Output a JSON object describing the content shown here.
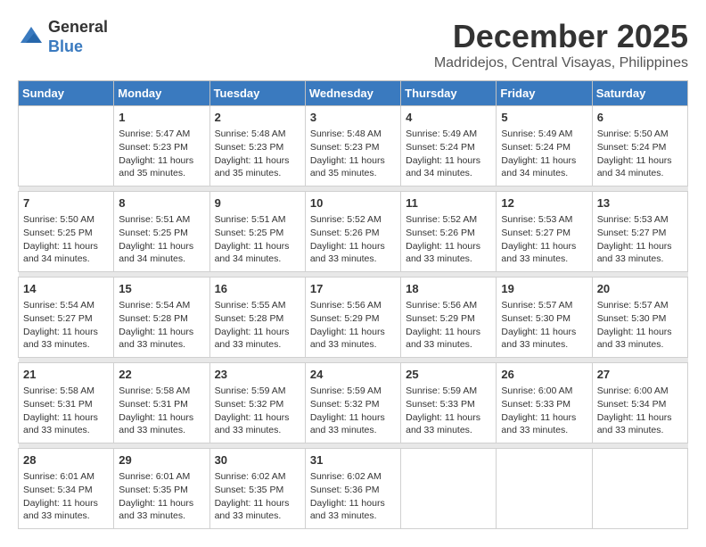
{
  "header": {
    "logo_general": "General",
    "logo_blue": "Blue",
    "title": "December 2025",
    "subtitle": "Madridejos, Central Visayas, Philippines"
  },
  "calendar": {
    "weekdays": [
      "Sunday",
      "Monday",
      "Tuesday",
      "Wednesday",
      "Thursday",
      "Friday",
      "Saturday"
    ],
    "weeks": [
      [
        {
          "day": "",
          "sunrise": "",
          "sunset": "",
          "daylight": ""
        },
        {
          "day": "1",
          "sunrise": "Sunrise: 5:47 AM",
          "sunset": "Sunset: 5:23 PM",
          "daylight": "Daylight: 11 hours and 35 minutes."
        },
        {
          "day": "2",
          "sunrise": "Sunrise: 5:48 AM",
          "sunset": "Sunset: 5:23 PM",
          "daylight": "Daylight: 11 hours and 35 minutes."
        },
        {
          "day": "3",
          "sunrise": "Sunrise: 5:48 AM",
          "sunset": "Sunset: 5:23 PM",
          "daylight": "Daylight: 11 hours and 35 minutes."
        },
        {
          "day": "4",
          "sunrise": "Sunrise: 5:49 AM",
          "sunset": "Sunset: 5:24 PM",
          "daylight": "Daylight: 11 hours and 34 minutes."
        },
        {
          "day": "5",
          "sunrise": "Sunrise: 5:49 AM",
          "sunset": "Sunset: 5:24 PM",
          "daylight": "Daylight: 11 hours and 34 minutes."
        },
        {
          "day": "6",
          "sunrise": "Sunrise: 5:50 AM",
          "sunset": "Sunset: 5:24 PM",
          "daylight": "Daylight: 11 hours and 34 minutes."
        }
      ],
      [
        {
          "day": "7",
          "sunrise": "Sunrise: 5:50 AM",
          "sunset": "Sunset: 5:25 PM",
          "daylight": "Daylight: 11 hours and 34 minutes."
        },
        {
          "day": "8",
          "sunrise": "Sunrise: 5:51 AM",
          "sunset": "Sunset: 5:25 PM",
          "daylight": "Daylight: 11 hours and 34 minutes."
        },
        {
          "day": "9",
          "sunrise": "Sunrise: 5:51 AM",
          "sunset": "Sunset: 5:25 PM",
          "daylight": "Daylight: 11 hours and 34 minutes."
        },
        {
          "day": "10",
          "sunrise": "Sunrise: 5:52 AM",
          "sunset": "Sunset: 5:26 PM",
          "daylight": "Daylight: 11 hours and 33 minutes."
        },
        {
          "day": "11",
          "sunrise": "Sunrise: 5:52 AM",
          "sunset": "Sunset: 5:26 PM",
          "daylight": "Daylight: 11 hours and 33 minutes."
        },
        {
          "day": "12",
          "sunrise": "Sunrise: 5:53 AM",
          "sunset": "Sunset: 5:27 PM",
          "daylight": "Daylight: 11 hours and 33 minutes."
        },
        {
          "day": "13",
          "sunrise": "Sunrise: 5:53 AM",
          "sunset": "Sunset: 5:27 PM",
          "daylight": "Daylight: 11 hours and 33 minutes."
        }
      ],
      [
        {
          "day": "14",
          "sunrise": "Sunrise: 5:54 AM",
          "sunset": "Sunset: 5:27 PM",
          "daylight": "Daylight: 11 hours and 33 minutes."
        },
        {
          "day": "15",
          "sunrise": "Sunrise: 5:54 AM",
          "sunset": "Sunset: 5:28 PM",
          "daylight": "Daylight: 11 hours and 33 minutes."
        },
        {
          "day": "16",
          "sunrise": "Sunrise: 5:55 AM",
          "sunset": "Sunset: 5:28 PM",
          "daylight": "Daylight: 11 hours and 33 minutes."
        },
        {
          "day": "17",
          "sunrise": "Sunrise: 5:56 AM",
          "sunset": "Sunset: 5:29 PM",
          "daylight": "Daylight: 11 hours and 33 minutes."
        },
        {
          "day": "18",
          "sunrise": "Sunrise: 5:56 AM",
          "sunset": "Sunset: 5:29 PM",
          "daylight": "Daylight: 11 hours and 33 minutes."
        },
        {
          "day": "19",
          "sunrise": "Sunrise: 5:57 AM",
          "sunset": "Sunset: 5:30 PM",
          "daylight": "Daylight: 11 hours and 33 minutes."
        },
        {
          "day": "20",
          "sunrise": "Sunrise: 5:57 AM",
          "sunset": "Sunset: 5:30 PM",
          "daylight": "Daylight: 11 hours and 33 minutes."
        }
      ],
      [
        {
          "day": "21",
          "sunrise": "Sunrise: 5:58 AM",
          "sunset": "Sunset: 5:31 PM",
          "daylight": "Daylight: 11 hours and 33 minutes."
        },
        {
          "day": "22",
          "sunrise": "Sunrise: 5:58 AM",
          "sunset": "Sunset: 5:31 PM",
          "daylight": "Daylight: 11 hours and 33 minutes."
        },
        {
          "day": "23",
          "sunrise": "Sunrise: 5:59 AM",
          "sunset": "Sunset: 5:32 PM",
          "daylight": "Daylight: 11 hours and 33 minutes."
        },
        {
          "day": "24",
          "sunrise": "Sunrise: 5:59 AM",
          "sunset": "Sunset: 5:32 PM",
          "daylight": "Daylight: 11 hours and 33 minutes."
        },
        {
          "day": "25",
          "sunrise": "Sunrise: 5:59 AM",
          "sunset": "Sunset: 5:33 PM",
          "daylight": "Daylight: 11 hours and 33 minutes."
        },
        {
          "day": "26",
          "sunrise": "Sunrise: 6:00 AM",
          "sunset": "Sunset: 5:33 PM",
          "daylight": "Daylight: 11 hours and 33 minutes."
        },
        {
          "day": "27",
          "sunrise": "Sunrise: 6:00 AM",
          "sunset": "Sunset: 5:34 PM",
          "daylight": "Daylight: 11 hours and 33 minutes."
        }
      ],
      [
        {
          "day": "28",
          "sunrise": "Sunrise: 6:01 AM",
          "sunset": "Sunset: 5:34 PM",
          "daylight": "Daylight: 11 hours and 33 minutes."
        },
        {
          "day": "29",
          "sunrise": "Sunrise: 6:01 AM",
          "sunset": "Sunset: 5:35 PM",
          "daylight": "Daylight: 11 hours and 33 minutes."
        },
        {
          "day": "30",
          "sunrise": "Sunrise: 6:02 AM",
          "sunset": "Sunset: 5:35 PM",
          "daylight": "Daylight: 11 hours and 33 minutes."
        },
        {
          "day": "31",
          "sunrise": "Sunrise: 6:02 AM",
          "sunset": "Sunset: 5:36 PM",
          "daylight": "Daylight: 11 hours and 33 minutes."
        },
        {
          "day": "",
          "sunrise": "",
          "sunset": "",
          "daylight": ""
        },
        {
          "day": "",
          "sunrise": "",
          "sunset": "",
          "daylight": ""
        },
        {
          "day": "",
          "sunrise": "",
          "sunset": "",
          "daylight": ""
        }
      ]
    ]
  }
}
